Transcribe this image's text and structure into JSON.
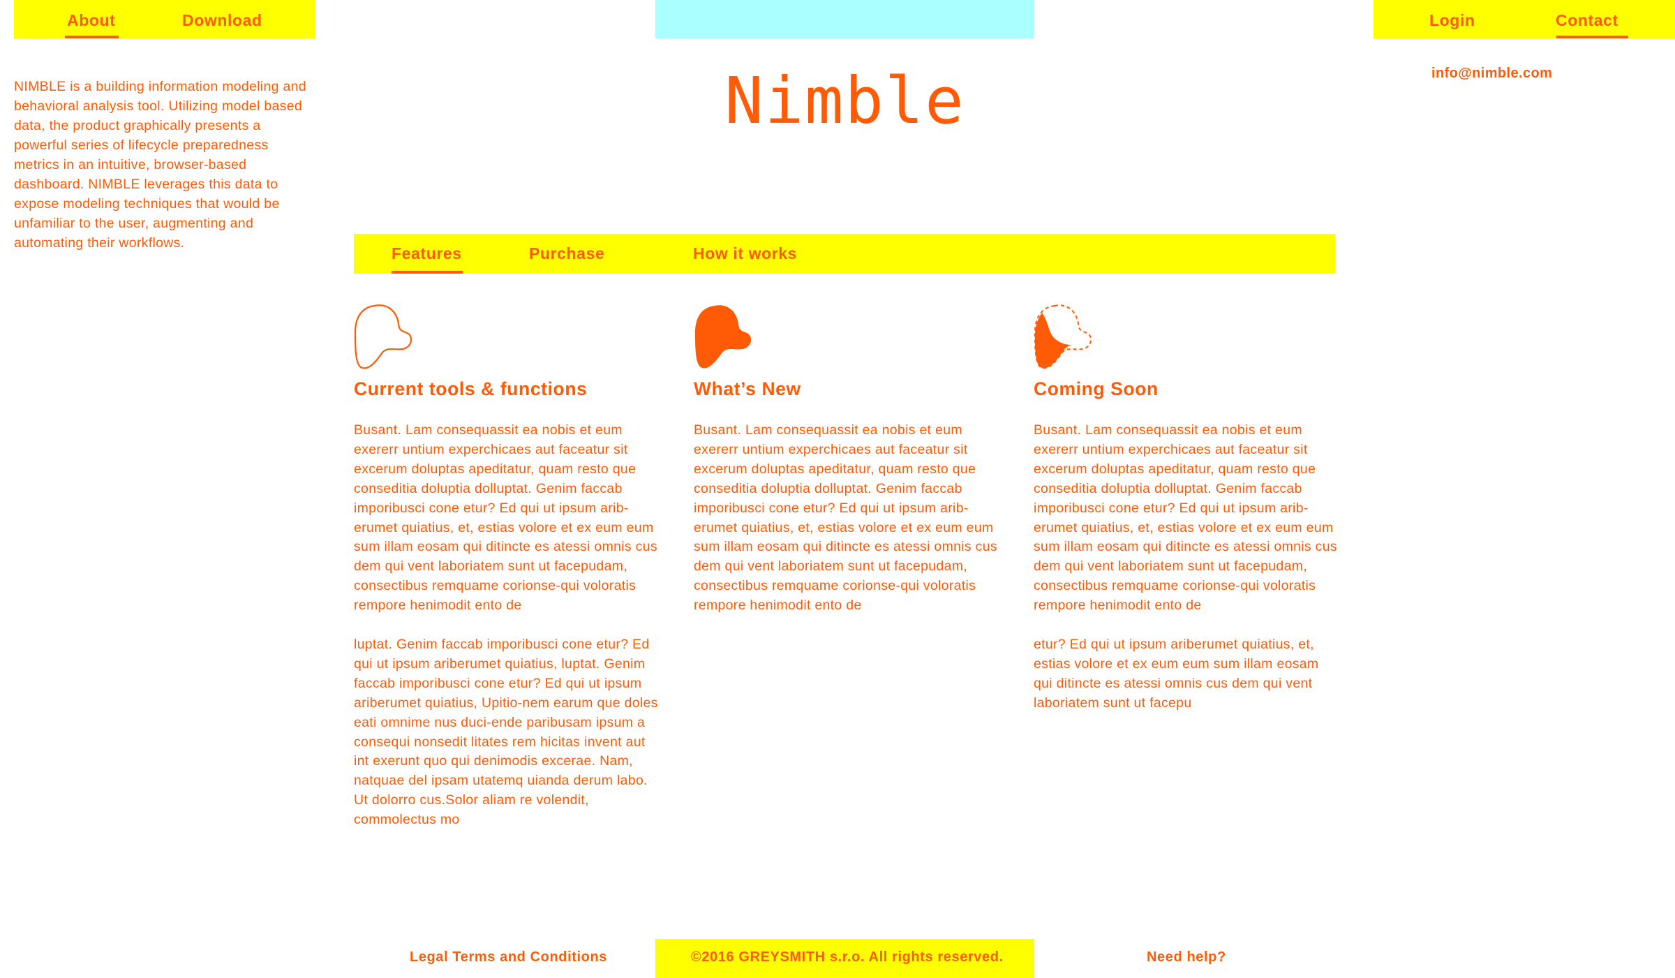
{
  "colors": {
    "accent": "#ff5a05",
    "yellow": "#ffff00",
    "cyan": "#aaffff",
    "background": "#ffffff"
  },
  "top_nav": {
    "left": [
      {
        "label": "About",
        "active": true
      },
      {
        "label": "Download",
        "active": false
      }
    ],
    "right": [
      {
        "label": "Login",
        "active": false
      },
      {
        "label": "Contact",
        "active": true
      }
    ]
  },
  "logo": "Nimble",
  "contact_email": "info@nimble.com",
  "about_text": "NIMBLE is a building information modeling and behavioral analysis tool. Utilizing model based data, the product graphically presents a powerful series of lifecycle preparedness metrics in an intuitive, browser-based dashboard. NIMBLE leverages this data to expose modeling techniques that would be unfamiliar to the user, augmenting and automating their workflows.",
  "sub_nav": [
    {
      "label": "Features",
      "active": true
    },
    {
      "label": "Purchase",
      "active": false
    },
    {
      "label": "How it works",
      "active": false
    }
  ],
  "columns": [
    {
      "icon": "blob-outline-icon",
      "title": "Current tools & functions",
      "body": "Busant. Lam consequassit ea nobis et eum exererr untium experchicaes aut faceatur sit excerum doluptas apeditatur, quam resto que conseditia doluptia dolluptat. Genim faccab imporibusci cone etur? Ed qui ut ipsum arib-erumet quiatius, et, estias volore et ex eum eum sum illam eosam qui ditincte es atessi omnis cus dem qui vent laboriatem sunt ut facepudam, consectibus remquame corionse-qui voloratis rempore henimodit ento de\n\nluptat. Genim faccab imporibusci cone etur? Ed qui ut ipsum ariberumet quiatius, luptat. Genim faccab imporibusci cone etur? Ed qui ut ipsum ariberumet quiatius, Upitio-nem earum que doles eati omnime nus duci-ende paribusam ipsum a consequi nonsedit litates rem hicitas invent aut int exerunt quo qui denimodis excerae. Nam, natquae del ipsam utatemq uianda derum labo. Ut dolorro cus.Solor aliam re volendit, commolectus mo"
    },
    {
      "icon": "blob-filled-icon",
      "title": "What’s New",
      "body": "Busant. Lam consequassit ea nobis et eum exererr untium experchicaes aut faceatur sit excerum doluptas apeditatur, quam resto que conseditia doluptia dolluptat. Genim faccab imporibusci cone etur? Ed qui ut ipsum arib-erumet quiatius, et, estias volore et ex eum eum sum illam eosam qui ditincte es atessi omnis cus dem qui vent laboriatem sunt ut facepudam, consectibus remquame corionse-qui voloratis rempore henimodit ento de"
    },
    {
      "icon": "blob-partial-icon",
      "title": "Coming Soon",
      "body": "Busant. Lam consequassit ea nobis et eum exererr untium experchicaes aut faceatur sit excerum doluptas apeditatur, quam resto que conseditia doluptia dolluptat. Genim faccab imporibusci cone etur? Ed qui ut ipsum arib-erumet quiatius, et, estias volore et ex eum eum sum illam eosam qui ditincte es atessi omnis cus dem qui vent laboriatem sunt ut facepudam, consectibus remquame corionse-qui voloratis rempore henimodit ento de\n\netur? Ed qui ut ipsum ariberumet quiatius, et, estias volore et ex eum eum sum illam eosam qui ditincte es atessi omnis cus dem qui vent laboriatem sunt ut facepu"
    }
  ],
  "footer": {
    "legal": "Legal Terms and Conditions",
    "copyright": "©2016 GREYSMITH s.r.o. All rights reserved.",
    "help": "Need help?"
  }
}
